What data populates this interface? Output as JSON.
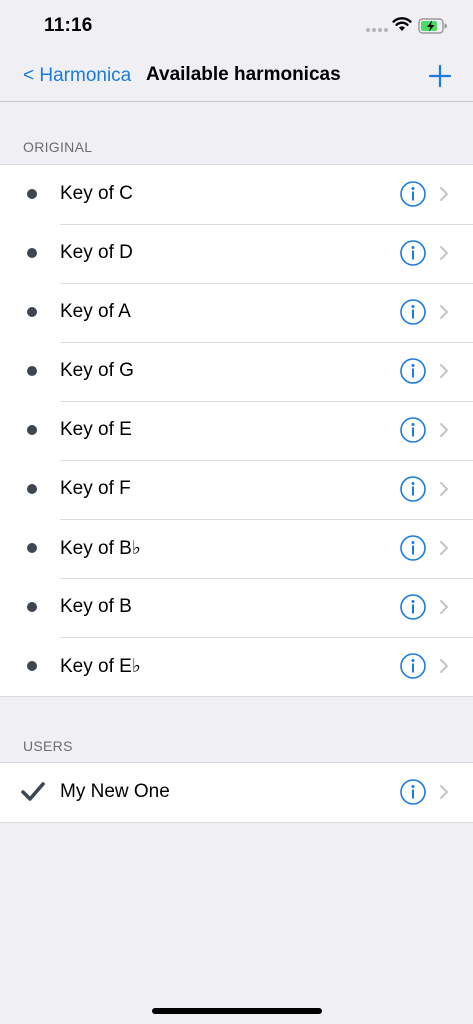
{
  "status_bar": {
    "time": "11:16"
  },
  "nav": {
    "back_label": "< Harmonica",
    "title": "Available harmonicas"
  },
  "sections": {
    "original": {
      "header": "ORIGINAL",
      "items": [
        {
          "label": "Key of C"
        },
        {
          "label": "Key of D"
        },
        {
          "label": "Key of A"
        },
        {
          "label": "Key of G"
        },
        {
          "label": "Key of E"
        },
        {
          "label": "Key of F"
        },
        {
          "label": "Key of B♭"
        },
        {
          "label": "Key of B"
        },
        {
          "label": "Key of E♭"
        }
      ]
    },
    "users": {
      "header": "USERS",
      "items": [
        {
          "label": "My New One",
          "selected": true
        }
      ]
    }
  },
  "colors": {
    "accent": "#1a7bdf",
    "bullet": "#3e4651",
    "background": "#efeff4"
  }
}
